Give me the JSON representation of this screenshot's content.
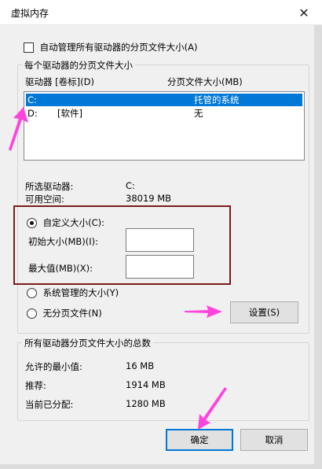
{
  "window": {
    "title": "虚拟内存",
    "close_glyph": "✕"
  },
  "auto_manage": {
    "label": "自动管理所有驱动器的分页文件大小(A)"
  },
  "per_drive": {
    "group_label": "每个驱动器的分页文件大小",
    "col_drive": "驱动器 [卷标](D)",
    "col_size": "分页文件大小(MB)",
    "rows": [
      {
        "drive": "C:",
        "label": "",
        "size": "托管的系统"
      },
      {
        "drive": "D:",
        "label": "[软件]",
        "size": "无"
      }
    ],
    "selected_drive_label": "所选驱动器:",
    "selected_drive_value": "C:",
    "free_space_label": "可用空间:",
    "free_space_value": "38019 MB"
  },
  "custom_size": {
    "label": "自定义大小(C):",
    "initial_label": "初始大小(MB)(I):",
    "initial_value": "",
    "max_label": "最大值(MB)(X):",
    "max_value": ""
  },
  "system_managed": {
    "label": "系统管理的大小(Y)"
  },
  "no_paging": {
    "label": "无分页文件(N)"
  },
  "buttons": {
    "set": "设置(S)",
    "ok": "确定",
    "cancel": "取消"
  },
  "totals": {
    "group_label": "所有驱动器分页文件大小的总数",
    "min_label": "允许的最小值:",
    "min_value": "16 MB",
    "recommended_label": "推荐:",
    "recommended_value": "1914 MB",
    "current_label": "当前已分配:",
    "current_value": "1280 MB"
  },
  "colors": {
    "annotation_arrow": "#ff44dd",
    "highlight_box": "#7b1c1c",
    "selection": "#0078d7"
  }
}
